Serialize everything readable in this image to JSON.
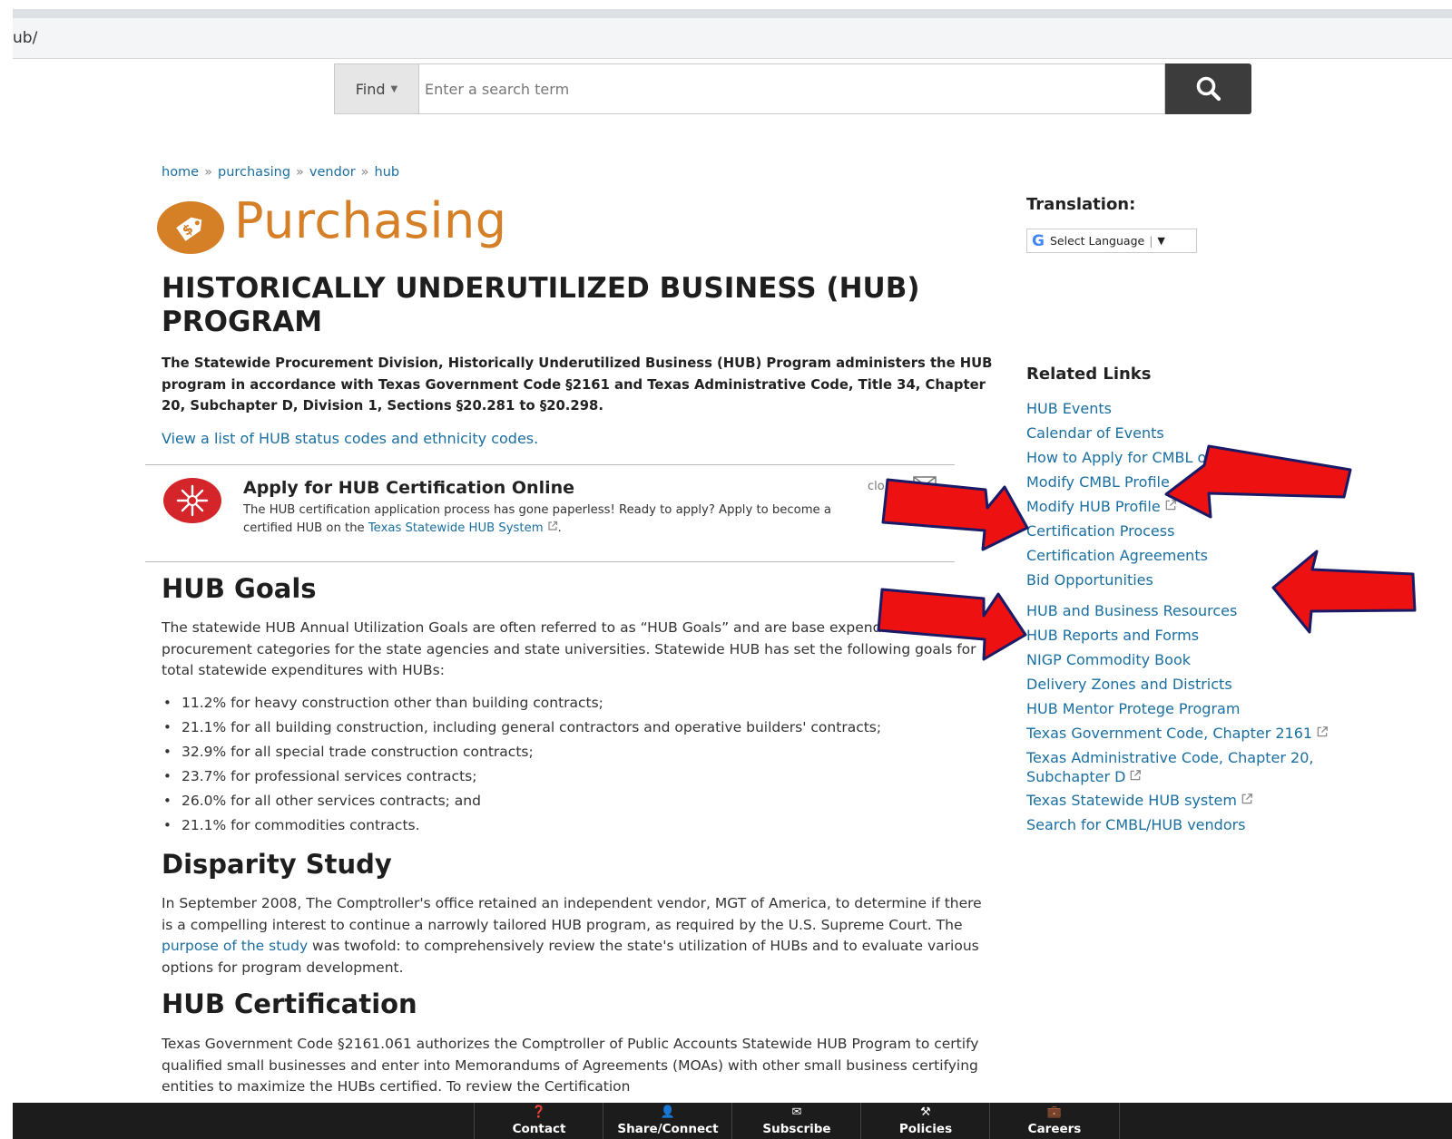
{
  "browser": {
    "url_fragment": "ub/"
  },
  "search": {
    "find_label": "Find",
    "placeholder": "Enter a search term",
    "icon": "search-icon"
  },
  "breadcrumb": [
    {
      "label": "home"
    },
    {
      "label": "purchasing"
    },
    {
      "label": "vendor"
    },
    {
      "label": "hub"
    }
  ],
  "breadcrumb_separator": "»",
  "header": {
    "department": "Purchasing",
    "logo_icon": "price-tag-dollar-icon",
    "accent_color": "#d57f26"
  },
  "page": {
    "title": "HISTORICALLY UNDERUTILIZED BUSINESS (HUB) PROGRAM",
    "intro": "The Statewide Procurement Division, Historically Underutilized Business (HUB) Program administers the HUB program in accordance with Texas Government Code §2161 and Texas Administrative Code, Title 34, Chapter 20, Subchapter D, Division 1, Sections §20.281 to §20.298.",
    "status_link": "View a list of HUB status codes and ethnicity codes."
  },
  "alert": {
    "title": "Apply for HUB Certification Online",
    "text_before": "The HUB certification application process has gone paperless! Ready to apply? Apply to become a certified HUB on the ",
    "link": "Texas Statewide HUB System",
    "text_after": ".",
    "close_label": "clo",
    "icon": "alert-starburst-icon"
  },
  "goals": {
    "heading": "HUB Goals",
    "text": "The statewide HUB Annual Utilization Goals are often referred to as “HUB Goals” and are base expenditures by procurement categories for the state agencies and state universities. Statewide HUB has set the following goals for total statewide expenditures with HUBs:",
    "items": [
      "11.2% for heavy construction other than building contracts;",
      "21.1% for all building construction, including general contractors and operative builders' contracts;",
      "32.9% for all special trade construction contracts;",
      "23.7% for professional services contracts;",
      "26.0% for all other services contracts; and",
      "21.1% for commodities contracts."
    ]
  },
  "disparity": {
    "heading": "Disparity Study",
    "text_before": "In September 2008, The Comptroller's office retained an independent vendor, MGT of America, to determine if there is a compelling interest to continue a narrowly tailored HUB program, as required by the U.S. Supreme Court. The ",
    "link": "purpose of the study",
    "text_after": " was twofold: to comprehensively review the state's utilization of HUBs and to evaluate various options for program development."
  },
  "certification": {
    "heading": "HUB Certification",
    "text": "Texas Government Code §2161.061 authorizes the Comptroller of Public Accounts Statewide HUB Program to certify qualified small businesses and enter into Memorandums of Agreements (MOAs) with other small business certifying entities to maximize the HUBs certified. To review the Certification"
  },
  "sidebar": {
    "translation_label": "Translation:",
    "language_select": "Select Language",
    "google_glyph": "G",
    "related_heading": "Related Links",
    "links": [
      {
        "label": "HUB Events",
        "external": false
      },
      {
        "label": "Calendar of Events",
        "external": false
      },
      {
        "label": "How to Apply for CMBL or HUB",
        "external": false
      },
      {
        "label": "Modify CMBL Profile",
        "external": false
      },
      {
        "label": "Modify HUB Profile",
        "external": true
      },
      {
        "label": "Certification Process",
        "external": false
      },
      {
        "label": "Certification Agreements",
        "external": false
      },
      {
        "label": "Bid Opportunities",
        "external": false
      },
      {
        "label": "HUB and Business Resources",
        "external": false
      },
      {
        "label": "HUB Reports and Forms",
        "external": false
      },
      {
        "label": "NIGP Commodity Book",
        "external": false
      },
      {
        "label": "Delivery Zones and Districts",
        "external": false
      },
      {
        "label": "HUB Mentor Protege Program",
        "external": false
      },
      {
        "label": "Texas Government Code, Chapter 2161",
        "external": true
      },
      {
        "label": "Texas Administrative Code, Chapter 20, Subchapter D",
        "external": true
      },
      {
        "label": "Texas Statewide HUB system",
        "external": true
      },
      {
        "label": "Search for CMBL/HUB vendors",
        "external": false
      }
    ]
  },
  "footer": [
    {
      "label": "Contact",
      "icon": "question-circle-icon",
      "glyph": "❓"
    },
    {
      "label": "Share/Connect",
      "icon": "user-icon",
      "glyph": "👤"
    },
    {
      "label": "Subscribe",
      "icon": "envelope-icon",
      "glyph": "✉"
    },
    {
      "label": "Policies",
      "icon": "gavel-icon",
      "glyph": "⚒"
    },
    {
      "label": "Careers",
      "icon": "briefcase-icon",
      "glyph": "💼"
    }
  ],
  "colors": {
    "link": "#1a6fa0",
    "annotation_arrow": "#ee1111",
    "footer_bg": "#1c1c1c"
  }
}
